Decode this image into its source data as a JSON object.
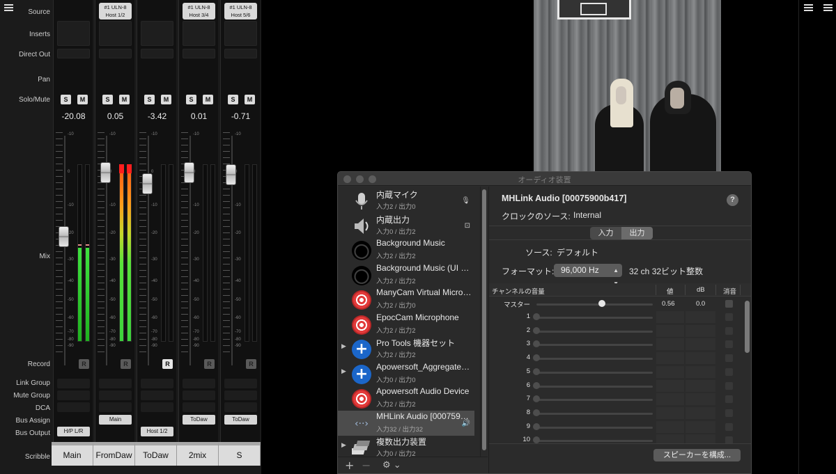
{
  "mixer": {
    "row_labels": {
      "source": "Source",
      "inserts": "Inserts",
      "direct_out": "Direct Out",
      "pan": "Pan",
      "solo_mute": "Solo/Mute",
      "mix": "Mix",
      "record": "Record",
      "link_group": "Link Group",
      "mute_group": "Mute Group",
      "dca": "DCA",
      "bus_assign": "Bus Assign",
      "bus_output": "Bus Output",
      "scribble": "Scribble"
    },
    "scale_labels": [
      "-10",
      "0",
      "-10",
      "-20",
      "-30",
      "-40",
      "-50",
      "-60",
      "-70",
      "-80",
      "-90"
    ],
    "solo_label": "S",
    "mute_label": "M",
    "record_label": "R",
    "channels": [
      {
        "source_line1": "",
        "source_line2": "",
        "value": "-20.08",
        "bus_output": "H/P L/R",
        "scribble": "Main",
        "record_active": false,
        "fader_level_db": -20.08,
        "meter_level": 0.53
      },
      {
        "source_line1": "#1 ULN-8",
        "source_line2": "Host 1/2",
        "value": "0.05",
        "bus_output": "Main",
        "scribble": "FromDaw",
        "record_active": false,
        "fader_level_db": 0.05,
        "meter_level": 0.98,
        "clip": true
      },
      {
        "source_line1": "",
        "source_line2": "",
        "value": "-3.42",
        "bus_output": "Host 1/2",
        "scribble": "ToDaw",
        "record_active": true,
        "fader_level_db": -3.42,
        "meter_level": 0
      },
      {
        "source_line1": "#1 ULN-8",
        "source_line2": "Host 3/4",
        "value": "0.01",
        "bus_output": "ToDaw",
        "scribble": "2mix",
        "record_active": false,
        "fader_level_db": 0.01,
        "meter_level": 0
      },
      {
        "source_line1": "#1 ULN-8",
        "source_line2": "Host 5/6",
        "value": "-0.71",
        "bus_output": "ToDaw",
        "scribble": "S",
        "record_active": false,
        "fader_level_db": -0.71,
        "meter_level": 0
      }
    ]
  },
  "audio_window": {
    "title": "オーディオ装置",
    "devices": [
      {
        "name": "内蔵マイク",
        "io": "入力2 / 出力0",
        "icon": "microphone-icon",
        "badge": "🎙",
        "expandable": false
      },
      {
        "name": "内蔵出力",
        "io": "入力0 / 出力2",
        "icon": "speaker-icon",
        "badge": "⊡",
        "expandable": false
      },
      {
        "name": "Background Music",
        "io": "入力2 / 出力2",
        "icon": "bgm-icon",
        "badge": "",
        "expandable": false
      },
      {
        "name": "Background Music (UI Sounds)",
        "io": "入力2 / 出力2",
        "icon": "bgm-icon",
        "badge": "",
        "expandable": false
      },
      {
        "name": "ManyCam Virtual Microphone",
        "io": "入力2 / 出力0",
        "icon": "target-icon",
        "badge": "",
        "expandable": false
      },
      {
        "name": "EpocCam Microphone",
        "io": "入力2 / 出力2",
        "icon": "target-icon",
        "badge": "",
        "expandable": false
      },
      {
        "name": "Pro Tools 機器セット",
        "io": "入力2 / 出力2",
        "icon": "aggregate-plus-icon",
        "badge": "",
        "expandable": true
      },
      {
        "name": "Apowersoft_AggregateDevice",
        "io": "入力0 / 出力0",
        "icon": "aggregate-plus-icon",
        "badge": "",
        "expandable": true
      },
      {
        "name": "Apowersoft Audio Device",
        "io": "入力2 / 出力2",
        "icon": "target-icon",
        "badge": "",
        "expandable": false
      },
      {
        "name": "MHLink Audio [00075900b417]",
        "io": "入力32 / 出力32",
        "icon": "network-audio-icon",
        "badge": "🔊",
        "expandable": false,
        "selected": true
      },
      {
        "name": "複数出力装置",
        "io": "入力0 / 出力2",
        "icon": "multi-output-icon",
        "badge": "",
        "expandable": true
      }
    ],
    "footer": {
      "add": "+",
      "remove": "−",
      "gear": "⚙ ⌄"
    },
    "detail": {
      "device_name": "MHLink Audio [00075900b417]",
      "help": "?",
      "clock_label": "クロックのソース:",
      "clock_value": "Internal",
      "tabs": [
        "入力",
        "出力"
      ],
      "active_tab": "出力",
      "source_label": "ソース:",
      "source_value": "デフォルト",
      "format_label": "フォーマット:",
      "format_value": "96,000 Hz",
      "format_desc": "32 ch 32ビット整数",
      "columns": {
        "channel": "チャンネルの音量",
        "value": "値",
        "db": "dB",
        "mute": "消音"
      },
      "master": {
        "label": "マスター",
        "value": "0.56",
        "db": "0.0",
        "level": 0.56
      },
      "channels": [
        "1",
        "2",
        "3",
        "4",
        "5",
        "6",
        "7",
        "8",
        "9",
        "10"
      ],
      "configure_button": "スピーカーを構成..."
    }
  }
}
